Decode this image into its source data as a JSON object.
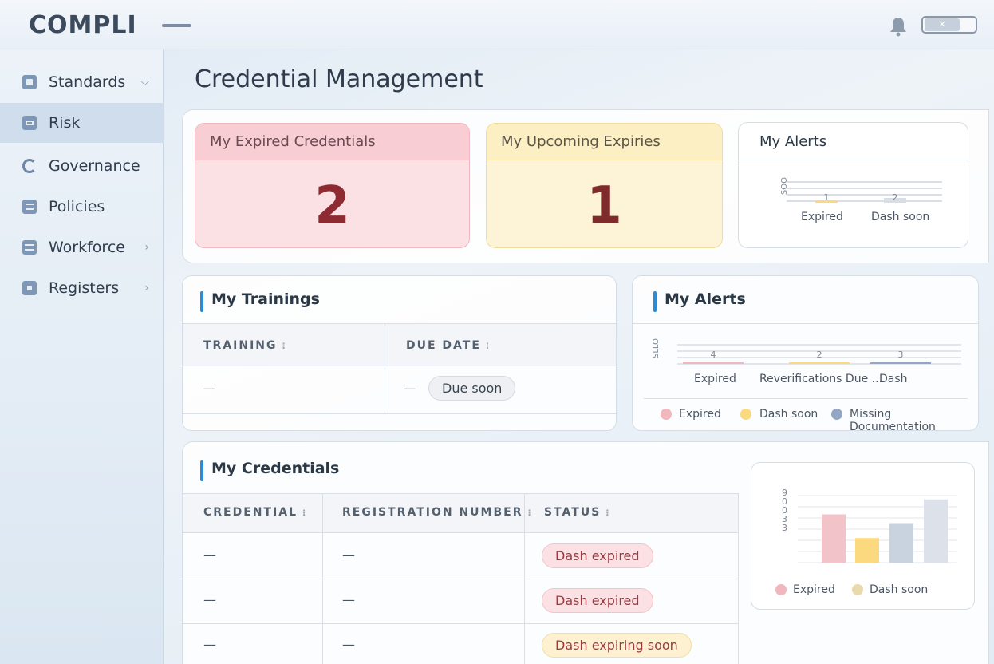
{
  "app": {
    "logo": "COMPLI"
  },
  "sidebar": {
    "items": [
      {
        "label": "Standards",
        "chevron": "⌵"
      },
      {
        "label": "Risk"
      },
      {
        "label": "Governance"
      },
      {
        "label": "Policies"
      },
      {
        "label": "Workforce",
        "chevron": "›"
      },
      {
        "label": "Registers",
        "chevron": "›"
      }
    ]
  },
  "page": {
    "title": "Credential Management"
  },
  "stats": {
    "expired": {
      "title": "My Expired Credentials",
      "value": "2"
    },
    "upcoming": {
      "title": "My Upcoming Expiries",
      "value": "1"
    }
  },
  "alerts_top": {
    "title": "My Alerts",
    "axis_glyph": "SOO",
    "chart_data": {
      "type": "bar",
      "categories": [
        "Expired",
        "Dash soon"
      ],
      "values": [
        1,
        2
      ]
    }
  },
  "trainings": {
    "title": "My Trainings",
    "columns": [
      "TRAINING",
      "DUE DATE"
    ],
    "rows": [
      {
        "training": "—",
        "due": "—",
        "badge": "Due soon"
      }
    ]
  },
  "alerts_mid": {
    "title": "My Alerts",
    "axis_glyph": "SLLO",
    "chart_data": {
      "type": "bar",
      "categories": [
        "Expired",
        "Reverifications Due ...",
        "Dash"
      ],
      "values": [
        4,
        2,
        3
      ]
    },
    "legend": [
      "Expired",
      "Dash soon",
      "Missing Documentation"
    ],
    "colors": {
      "expired": "#f2b6bd",
      "soon": "#fbd97e",
      "missing": "#93a7c4"
    }
  },
  "credentials": {
    "title": "My Credentials",
    "columns": [
      "CREDENTIAL",
      "REGISTRATION NUMBER",
      "STATUS"
    ],
    "rows": [
      {
        "credential": "—",
        "reg": "—",
        "status": "Dash expired",
        "kind": "red"
      },
      {
        "credential": "—",
        "reg": "—",
        "status": "Dash expired",
        "kind": "red"
      },
      {
        "credential": "—",
        "reg": "—",
        "status": "Dash expiring soon",
        "kind": "yellow"
      }
    ]
  },
  "cred_chart": {
    "axis_ticks": [
      "9",
      "0",
      "0",
      "3",
      "3"
    ],
    "legend": [
      "Expired",
      "Dash soon"
    ],
    "chart_data": {
      "type": "bar",
      "bars": [
        {
          "value": 0.55,
          "color": "#f2c3c9"
        },
        {
          "value": 0.28,
          "color": "#fbd97e"
        },
        {
          "value": 0.45,
          "color": "#c9d3e0"
        },
        {
          "value": 0.72,
          "color": "#dde2ea"
        }
      ]
    }
  }
}
